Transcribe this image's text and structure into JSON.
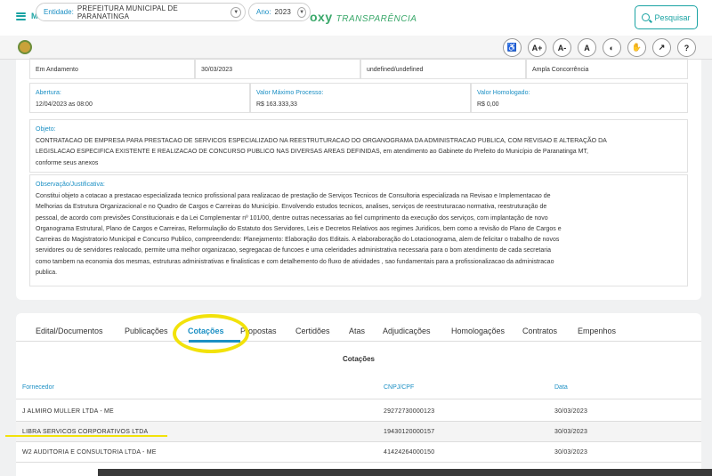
{
  "header": {
    "menu_label": "MENU",
    "logo_oxy": "oxy",
    "logo_transparencia": "TRANSPARÊNCIA",
    "search_label": "Pesquisar"
  },
  "filters": {
    "entity_label": "Entidade:",
    "entity_value": "PREFEITURA MUNICIPAL DE PARANATINGA",
    "year_label": "Ano:",
    "year_value": "2023"
  },
  "accessibility": {
    "increase_font": "A+",
    "decrease_font": "A-",
    "reset_font": "A",
    "help": "?"
  },
  "details": {
    "situacao_value": "Em Andamento",
    "publicacao_value": "30/03/2023",
    "processo_value": "undefined/undefined",
    "tipo_value": "Ampla Concorrência",
    "abertura_label": "Abertura:",
    "abertura_value": "12/04/2023 as 08:00",
    "valor_max_label": "Valor Máximo Processo:",
    "valor_max_value": "R$ 163.333,33",
    "valor_hom_label": "Valor Homologado:",
    "valor_hom_value": "R$ 0,00",
    "objeto_label": "Objeto:",
    "objeto_lines": [
      "CONTRATACAO DE EMPRESA PARA PRESTACAO DE SERVICOS ESPECIALIZADO NA REESTRUTURACAO DO ORGANOGRAMA DA ADMINISTRACAO PUBLICA, COM REVISAO E ALTERAÇÃO DA",
      "LEGISLACAO ESPECIFICA EXISTENTE E REALIZACAO DE CONCURSO PUBLICO NAS DIVERSAS AREAS DEFINIDAS, em atendimento ao Gabinete do Prefeito do Município de Paranatinga MT,",
      "conforme seus anexos"
    ],
    "obs_label": "Observação/Justificativa:",
    "obs_lines": [
      "Constitui objeto a cotacao a prestacao especializada tecnico profissional para realizacao de prestação de Serviços Tecnicos de Consultoria especializada na Revisao e Implementacao de",
      "Melhorias da Estrutura Organizacional e no Quadro de Cargos e Carreiras do Município. Envolvendo estudos tecnicos, analises, serviços de reestruturacao normativa, reestruturação de",
      "pessoal, de acordo com previsões Constitucionais e da Lei Complementar nº 101/00, dentre outras necessarias ao fiel cumprimento da execução dos serviços, com implantação de novo",
      "Organograma Estrutural, Plano de Cargos e Carreiras, Reformulação do Estatuto dos Servidores, Leis e Decretos Relativos aos regimes Juridicos, bem como a revisão do Plano de Cargos e",
      "Carreiras do Magistratorio Municipal e Concurso Publico, compreendendo: Planejamento: Elaboração dos Editais. A elaboraboração do Lotacionograma, alem de felicitar o trabalho de novos",
      "servidores ou de servidores realocado, permite uma melhor organizacao, segregacao de funcoes e uma celeridades administrativa necessaria para o bom atendimento de cada secretaria",
      "como tambem na economia dos mesmas, estruturas administrativas e finalisticas e com detalhemento do fluxo de atividades , sao fundamentais para a profissionalizacao da administracao",
      "publica."
    ]
  },
  "tabs": [
    {
      "label": "Edital/Documentos"
    },
    {
      "label": "Publicações"
    },
    {
      "label": "Cotações"
    },
    {
      "label": "Propostas"
    },
    {
      "label": "Certidões"
    },
    {
      "label": "Atas"
    },
    {
      "label": "Adjudicações"
    },
    {
      "label": "Homologações"
    },
    {
      "label": "Contratos"
    },
    {
      "label": "Empenhos"
    }
  ],
  "active_tab": "Cotações",
  "cotacoes": {
    "title": "Cotações",
    "columns": [
      "Fornecedor",
      "CNPJ/CPF",
      "Data"
    ],
    "rows": [
      {
        "fornecedor": "J ALMIRO MULLER LTDA - ME",
        "cnpj": "29272730000123",
        "data": "30/03/2023"
      },
      {
        "fornecedor": "LIBRA SERVICOS CORPORATIVOS LTDA",
        "cnpj": "19430120000157",
        "data": "30/03/2023"
      },
      {
        "fornecedor": "W2 AUDITORIA E CONSULTORIA LTDA - ME",
        "cnpj": "41424264000150",
        "data": "30/03/2023"
      }
    ]
  },
  "colors": {
    "accent": "#1a8fc4",
    "brand": "#3aa86a",
    "highlight": "#f2e20a"
  }
}
